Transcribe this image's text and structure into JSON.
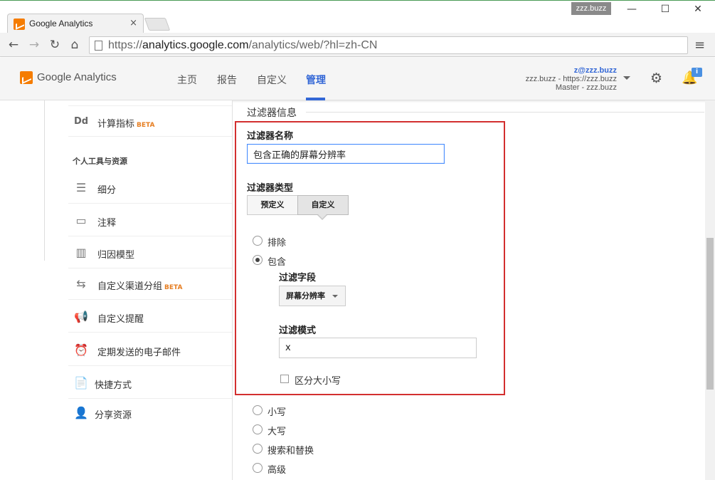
{
  "browser": {
    "tab_title": "Google Analytics",
    "tab_close": "×",
    "profile_badge": "zzz.buzz",
    "window_minimize": "—",
    "window_maximize": "☐",
    "window_close": "✕",
    "back": "←",
    "forward": "→",
    "reload": "↻",
    "home": "⌂",
    "url_scheme": "https://",
    "url_host": "analytics.google.com",
    "url_path": "/analytics/web/?hl=zh-CN",
    "menu": "≡"
  },
  "header": {
    "logo_text": "Google Analytics",
    "nav": [
      {
        "label": "主页"
      },
      {
        "label": "报告"
      },
      {
        "label": "自定义"
      },
      {
        "label": "管理"
      }
    ],
    "active_nav": "管理",
    "account": {
      "email": "z@zzz.buzz",
      "property": "zzz.buzz - https://zzz.buzz",
      "view": "Master - zzz.buzz"
    },
    "notification_count": "i"
  },
  "sidebar": {
    "items_top": [
      {
        "icon": "Dd",
        "label": "计算指标",
        "badge": "BETA"
      }
    ],
    "section_title": "个人工具与资源",
    "items": [
      {
        "icon": "☰",
        "label": "细分",
        "badge": ""
      },
      {
        "icon": "▭",
        "label": "注释",
        "badge": ""
      },
      {
        "icon": "▥",
        "label": "归因模型",
        "badge": ""
      },
      {
        "icon": "⇆",
        "label": "自定义渠道分组",
        "badge": "BETA"
      },
      {
        "icon": "📢",
        "label": "自定义提醒",
        "badge": ""
      },
      {
        "icon": "⏰",
        "label": "定期发送的电子邮件",
        "badge": ""
      },
      {
        "icon": "📄",
        "label": "快捷方式",
        "badge": ""
      },
      {
        "icon": "👤",
        "label": "分享资源",
        "badge": ""
      }
    ]
  },
  "filter": {
    "section_title": "过滤器信息",
    "name_label": "过滤器名称",
    "name_value": "包含正确的屏幕分辨率",
    "type_label": "过滤器类型",
    "type_options": [
      "预定义",
      "自定义"
    ],
    "type_selected": "自定义",
    "mode_options": [
      {
        "label": "排除",
        "checked": false
      },
      {
        "label": "包含",
        "checked": true
      }
    ],
    "field_label": "过滤字段",
    "field_value": "屏幕分辨率",
    "pattern_label": "过滤模式",
    "pattern_value": "x",
    "case_sensitive_label": "区分大小写",
    "other_options": [
      "小写",
      "大写",
      "搜索和替换",
      "高级"
    ]
  },
  "colors": {
    "accent": "#3367d6",
    "highlight": "#d32f2f",
    "beta": "#e67e22",
    "logo": "#f57c00"
  }
}
